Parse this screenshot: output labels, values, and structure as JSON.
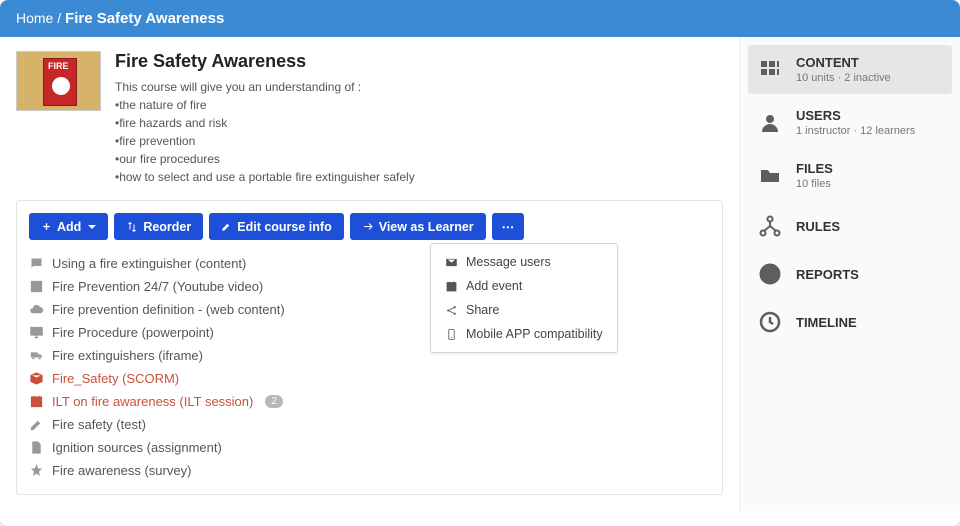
{
  "breadcrumb": {
    "home": "Home",
    "sep": " / ",
    "current": "Fire Safety Awareness"
  },
  "course": {
    "title": "Fire Safety Awareness",
    "desc_intro": "This course will give you an understanding of :",
    "desc_lines": [
      "•the nature of fire",
      "•fire hazards and risk",
      "•fire prevention",
      "•our fire procedures",
      "•how to select and use a portable fire extinguisher safely"
    ],
    "thumb_label": "FIRE"
  },
  "toolbar": {
    "add": "Add",
    "reorder": "Reorder",
    "edit": "Edit course info",
    "view_as": "View as Learner",
    "more": "⋯"
  },
  "dropdown": [
    {
      "icon": "envelope",
      "label": "Message users"
    },
    {
      "icon": "calendar",
      "label": "Add event"
    },
    {
      "icon": "share",
      "label": "Share"
    },
    {
      "icon": "mobile",
      "label": "Mobile APP compatibility"
    }
  ],
  "units": [
    {
      "icon": "comment",
      "label": "Using a fire extinguisher (content)",
      "inactive": false
    },
    {
      "icon": "film",
      "label": "Fire Prevention 24/7 (Youtube video)",
      "inactive": false
    },
    {
      "icon": "cloud",
      "label": "Fire prevention definition - (web content)",
      "inactive": false
    },
    {
      "icon": "monitor",
      "label": "Fire Procedure (powerpoint)",
      "inactive": false
    },
    {
      "icon": "truck",
      "label": "Fire extinguishers (iframe)",
      "inactive": false
    },
    {
      "icon": "box",
      "label": "Fire_Safety (SCORM)",
      "inactive": true
    },
    {
      "icon": "calendar",
      "label": "ILT on fire awareness (ILT session)",
      "inactive": true,
      "badge": "2"
    },
    {
      "icon": "pencil",
      "label": "Fire safety (test)",
      "inactive": false
    },
    {
      "icon": "doc",
      "label": "Ignition sources (assignment)",
      "inactive": false
    },
    {
      "icon": "star",
      "label": "Fire awareness (survey)",
      "inactive": false
    }
  ],
  "sidebar": [
    {
      "key": "content",
      "title": "CONTENT",
      "sub": "10 units · 2 inactive",
      "active": true
    },
    {
      "key": "users",
      "title": "USERS",
      "sub": "1 instructor · 12 learners"
    },
    {
      "key": "files",
      "title": "FILES",
      "sub": "10 files"
    },
    {
      "key": "rules",
      "title": "RULES",
      "sub": ""
    },
    {
      "key": "reports",
      "title": "REPORTS",
      "sub": ""
    },
    {
      "key": "timeline",
      "title": "TIMELINE",
      "sub": ""
    }
  ]
}
